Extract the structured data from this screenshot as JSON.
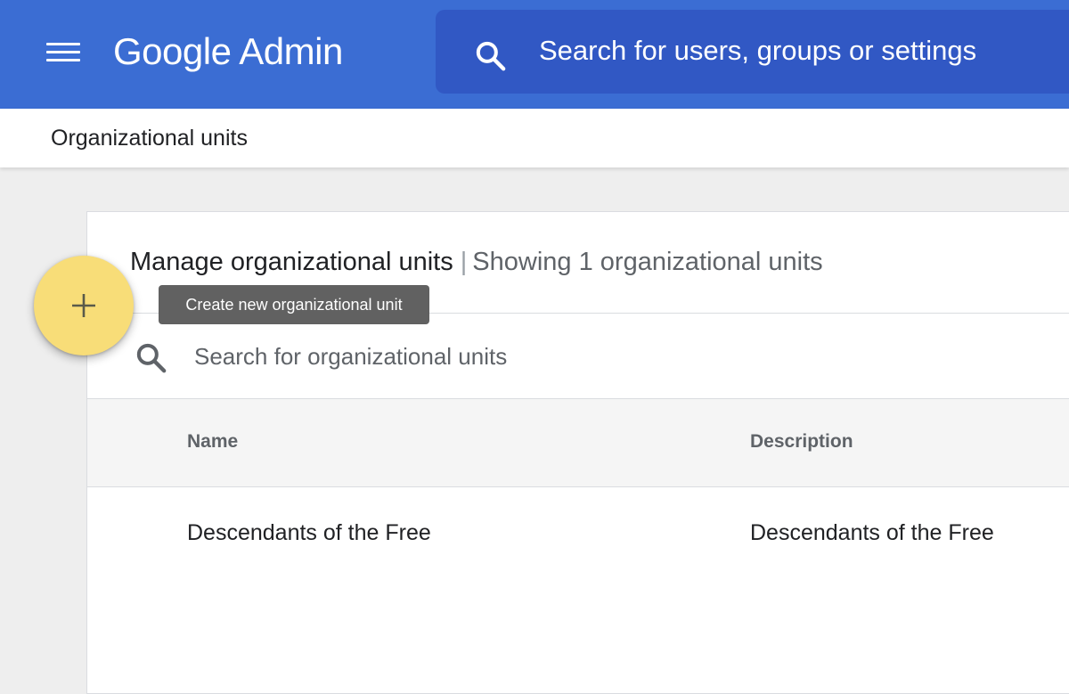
{
  "header": {
    "app_brand": "Google",
    "app_name": "Admin",
    "search_placeholder": "Search for users, groups or settings",
    "background_color": "#3b6dd3",
    "search_background_color": "#3158c4"
  },
  "breadcrumb": {
    "title": "Organizational units"
  },
  "card": {
    "title": "Manage organizational units",
    "separator": "|",
    "count_text": "Showing 1 organizational units"
  },
  "unit_search": {
    "placeholder": "Search for organizational units"
  },
  "table": {
    "columns": [
      "Name",
      "Description"
    ],
    "rows": [
      {
        "name": "Descendants of the Free",
        "description": "Descendants of the Free"
      }
    ]
  },
  "fab": {
    "icon": "plus-icon",
    "color": "#f8dd78",
    "tooltip": "Create new organizational unit"
  },
  "icons": {
    "menu": "hamburger-menu-icon",
    "search": "search-icon"
  }
}
